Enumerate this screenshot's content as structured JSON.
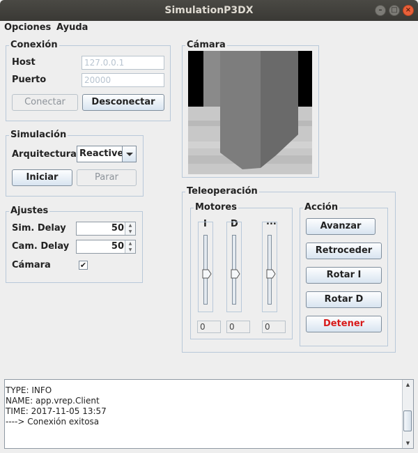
{
  "window": {
    "title": "SimulationP3DX"
  },
  "menu": {
    "items": [
      "Opciones",
      "Ayuda"
    ]
  },
  "conexion": {
    "legend": "Conexión",
    "host_label": "Host",
    "host_value": "127.0.0.1",
    "port_label": "Puerto",
    "port_value": "20000",
    "connect": "Conectar",
    "disconnect": "Desconectar"
  },
  "simulacion": {
    "legend": "Simulación",
    "arch_label": "Arquitectura",
    "arch_value": "Reactive",
    "start": "Iniciar",
    "stop": "Parar"
  },
  "ajustes": {
    "legend": "Ajustes",
    "sim_delay_label": "Sim. Delay",
    "sim_delay_value": "50",
    "cam_delay_label": "Cam. Delay",
    "cam_delay_value": "50",
    "camera_label": "Cámara",
    "camera_checked": true
  },
  "camara": {
    "legend": "Cámara"
  },
  "teleop": {
    "legend": "Teleoperación",
    "motores": {
      "legend": "Motores",
      "sliders": [
        {
          "label": "I",
          "value": "0",
          "level": 0.5
        },
        {
          "label": "D",
          "value": "0",
          "level": 0.5
        },
        {
          "label": "...",
          "value": "0",
          "level": 0.5
        }
      ]
    },
    "accion": {
      "legend": "Acción",
      "buttons": [
        "Avanzar",
        "Retroceder",
        "Rotar I",
        "Rotar D",
        "Detener"
      ]
    }
  },
  "console": {
    "lines": [
      "TYPE: INFO",
      "NAME: app.vrep.Client",
      "TIME: 2017-11-05 13:57",
      "----> Conexión exitosa"
    ]
  },
  "colors": {
    "stop_text": "#d81a1a",
    "titlebar": "#3c3b37",
    "close_button": "#e8603a"
  }
}
